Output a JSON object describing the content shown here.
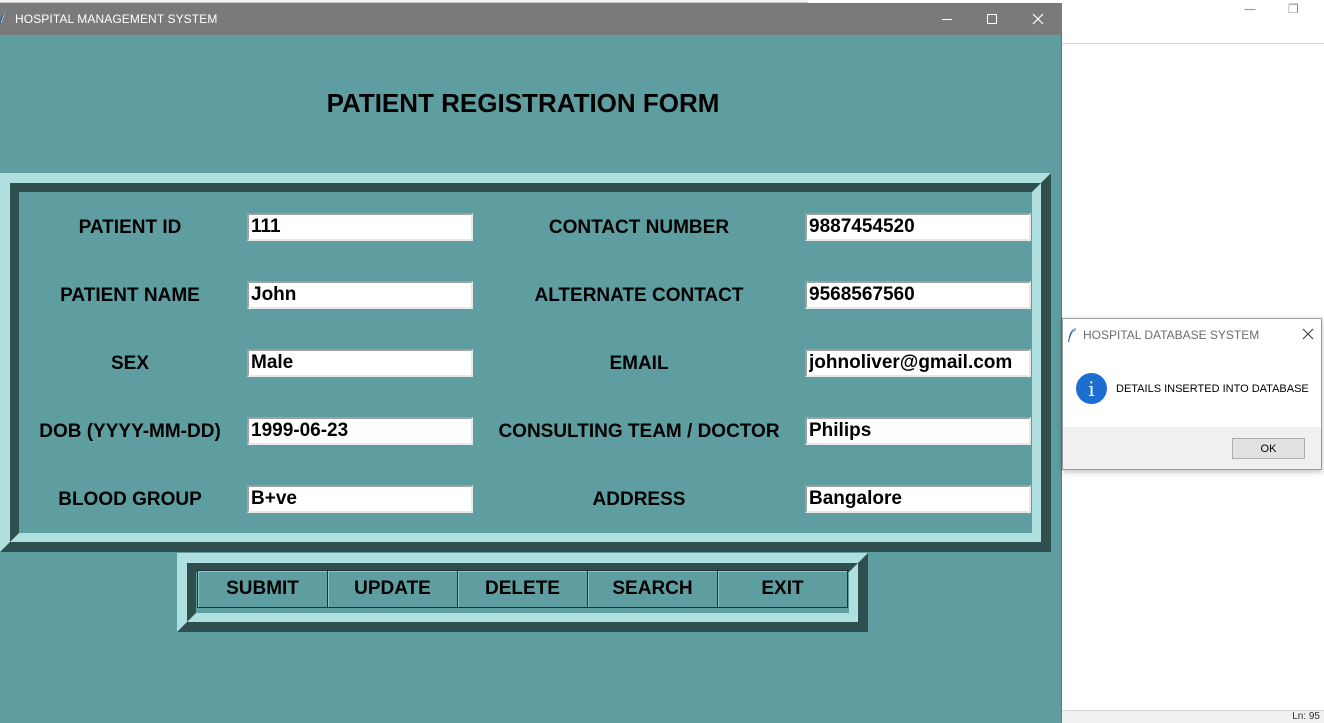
{
  "main_window": {
    "title": "HOSPITAL MANAGEMENT SYSTEM",
    "heading": "PATIENT REGISTRATION FORM"
  },
  "form": {
    "left_fields": [
      {
        "label": "PATIENT ID",
        "value": "111"
      },
      {
        "label": "PATIENT NAME",
        "value": "John"
      },
      {
        "label": "SEX",
        "value": "Male"
      },
      {
        "label": "DOB (YYYY-MM-DD)",
        "value": "1999-06-23"
      },
      {
        "label": "BLOOD GROUP",
        "value": "B+ve"
      }
    ],
    "right_fields": [
      {
        "label": "CONTACT NUMBER",
        "value": "9887454520"
      },
      {
        "label": "ALTERNATE CONTACT",
        "value": "9568567560"
      },
      {
        "label": "EMAIL",
        "value": "johnoliver@gmail.com"
      },
      {
        "label": "CONSULTING TEAM / DOCTOR",
        "value": "Philips"
      },
      {
        "label": "ADDRESS",
        "value": "Bangalore"
      }
    ]
  },
  "buttons": {
    "submit": "SUBMIT",
    "update": "UPDATE",
    "delete": "DELETE",
    "search": "SEARCH",
    "exit": "EXIT"
  },
  "message_box": {
    "title": "HOSPITAL DATABASE SYSTEM",
    "icon": "info-icon",
    "icon_glyph": "i",
    "message": "DETAILS INSERTED INTO DATABASE",
    "ok_label": "OK"
  },
  "background_editor": {
    "status": "Ln: 95"
  },
  "colors": {
    "window_bg": "#5f9ea0",
    "titlebar": "#7a7a7a",
    "frame_light": "#b0dfe0",
    "frame_dark": "#2f4f4f",
    "info_blue": "#1c6fd0"
  }
}
